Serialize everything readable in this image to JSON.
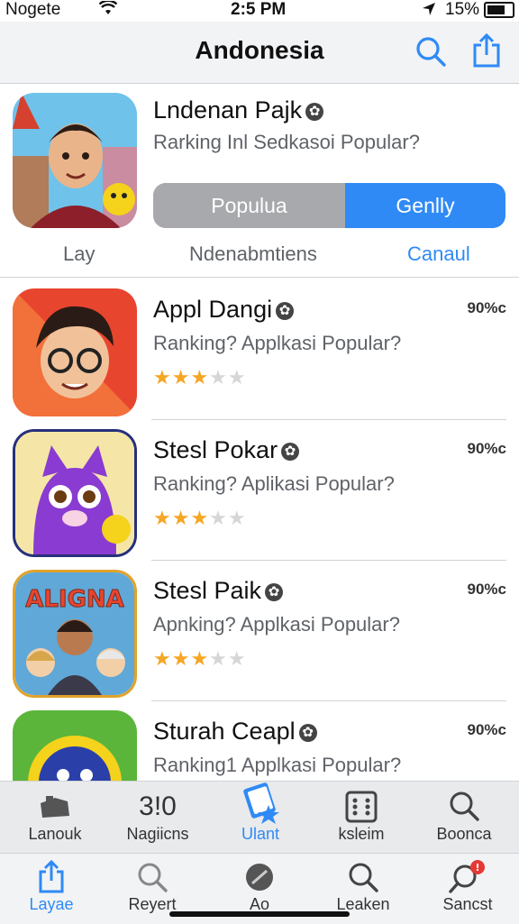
{
  "status": {
    "carrier": "Nogete",
    "time": "2:5 PM",
    "battery": "15%"
  },
  "nav": {
    "title": "Andonesia"
  },
  "featured": {
    "name": "Lndenan Pajk",
    "subtitle": "Rarking Inl Sedkasoi Popular?",
    "segment_left": "Populua",
    "segment_right": "Genlly",
    "label_left": "Lay",
    "label_mid": "Ndenabmtiens",
    "label_right": "Canaul"
  },
  "apps": [
    {
      "name": "Appl Dangi",
      "subtitle": "Ranking? Applkasi Popular?",
      "percent": "90%c",
      "rating": 3
    },
    {
      "name": "Stesl Pokar",
      "subtitle": "Ranking? Aplikasi Popular?",
      "percent": "90%c",
      "rating": 3
    },
    {
      "name": "Stesl Paik",
      "subtitle": "Apnking? Applkasi Popular?",
      "percent": "90%c",
      "rating": 3,
      "icon_text": "ALIGNA"
    },
    {
      "name": "Sturah Ceapl",
      "subtitle": "Ranking1 Applkasi Popular?",
      "percent": "90%c"
    }
  ],
  "tabbar_top": [
    {
      "label": "Lanouk",
      "icon": "gamepad-icon"
    },
    {
      "label": "Nagiicns",
      "icon": "310",
      "icon_text": "3!0"
    },
    {
      "label": "Ulant",
      "icon": "star-card-icon",
      "active": true
    },
    {
      "label": "ksleim",
      "icon": "dice-icon"
    },
    {
      "label": "Boonca",
      "icon": "search-icon"
    }
  ],
  "tabbar_bottom": [
    {
      "label": "Layae",
      "icon": "share-icon",
      "active": true
    },
    {
      "label": "Reyert",
      "icon": "search-icon"
    },
    {
      "label": "Ao",
      "icon": "bean-icon"
    },
    {
      "label": "Leaken",
      "icon": "search-icon"
    },
    {
      "label": "Sancst",
      "icon": "search-badge-icon",
      "badge": "!"
    }
  ],
  "colors": {
    "accent": "#2f8af5",
    "star": "#f5a623"
  }
}
